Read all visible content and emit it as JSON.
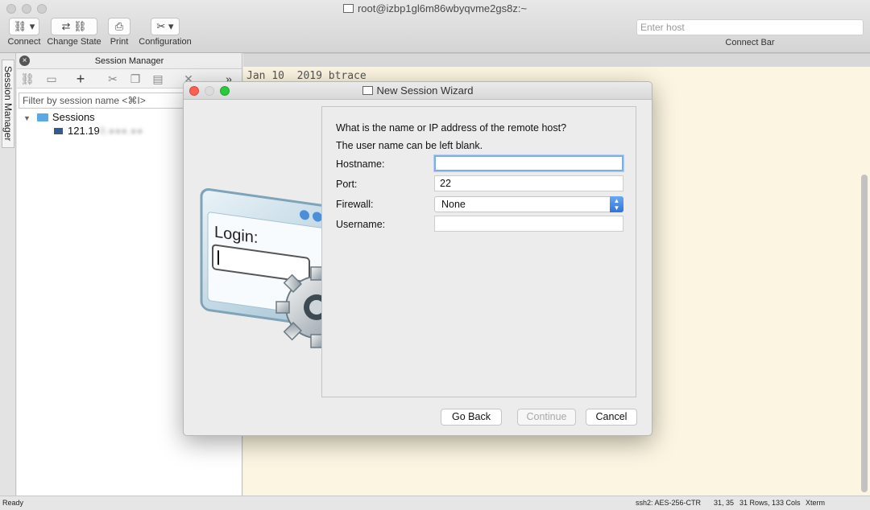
{
  "window": {
    "title": "root@izbp1gl6m86wbyqvme2gs8z:~"
  },
  "toolbar": {
    "connect_label": "Connect",
    "change_state_label": "Change State",
    "print_label": "Print",
    "configuration_label": "Configuration"
  },
  "connect_bar": {
    "placeholder": "Enter host",
    "label": "Connect Bar"
  },
  "side_tab": {
    "label": "Session Manager"
  },
  "session_manager": {
    "title": "Session Manager",
    "filter_placeholder": "Filter by session name <⌘I>",
    "tree": {
      "folder_label": "Sessions",
      "session_label_visible": "121.19",
      "session_label_redacted": "8.●●●.●●"
    }
  },
  "terminal": {
    "line": "Jan 10  2019 btrace"
  },
  "status_bar": {
    "state": "Ready",
    "cipher": "ssh2: AES-256-CTR",
    "cursor": "31, 35",
    "size": "31 Rows, 133 Cols",
    "term_type": "Xterm"
  },
  "dialog": {
    "title": "New Session Wizard",
    "question_line1": "What is the name or IP address of the remote host?",
    "question_line2": "The user name can be left blank.",
    "hostname_label": "Hostname:",
    "hostname_value": "",
    "port_label": "Port:",
    "port_value": "22",
    "firewall_label": "Firewall:",
    "firewall_value": "None",
    "username_label": "Username:",
    "username_value": "",
    "illustration_text": "Login:",
    "buttons": {
      "back": "Go Back",
      "continue": "Continue",
      "cancel": "Cancel"
    }
  },
  "colors": {
    "terminal_bg": "#fcf5e1",
    "close_light": "#fc5f57",
    "min_light": "#dcdcdc",
    "zoom_light": "#2ac93f",
    "select_accent": "#2f74d8"
  }
}
